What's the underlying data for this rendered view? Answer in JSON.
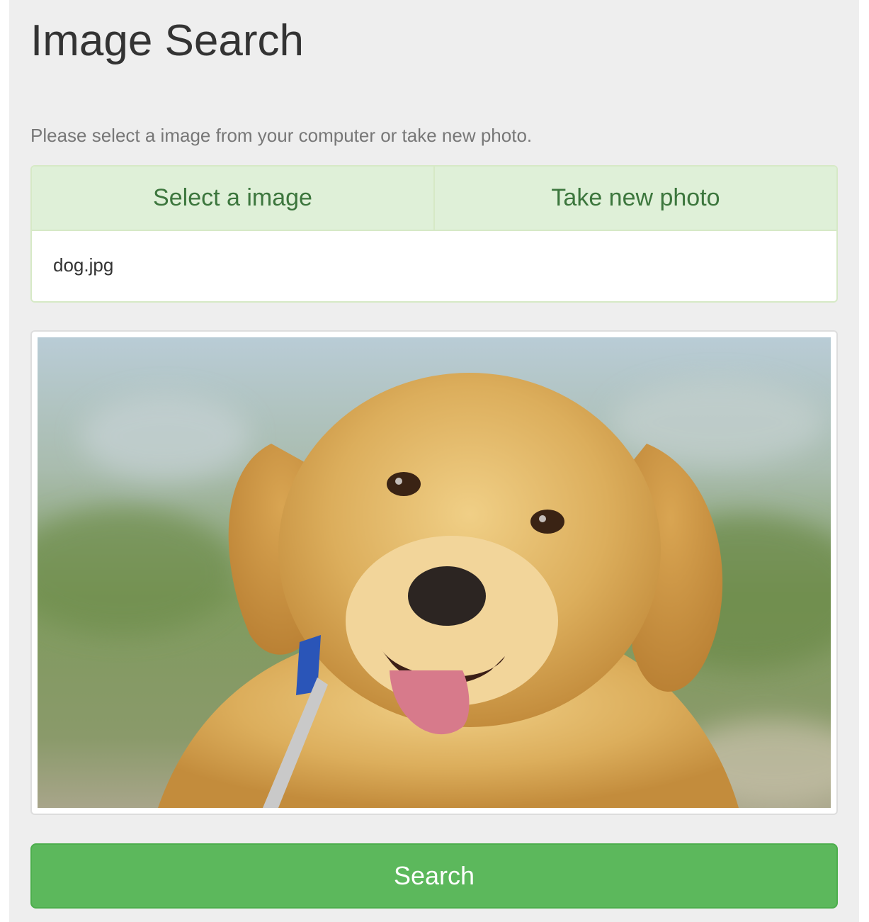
{
  "page": {
    "title": "Image Search",
    "instruction": "Please select a image from your computer or take new photo."
  },
  "image_picker": {
    "tabs": [
      {
        "label": "Select a image"
      },
      {
        "label": "Take new photo"
      }
    ],
    "selected_file": "dog.jpg"
  },
  "preview": {
    "image_subject": "golden retriever puppy"
  },
  "search_button": {
    "label": "Search"
  },
  "colors": {
    "page_background": "#eeeeee",
    "tab_background": "#dff0d8",
    "tab_text": "#3c763d",
    "button_background": "#5cb85c",
    "button_text": "#ffffff"
  }
}
